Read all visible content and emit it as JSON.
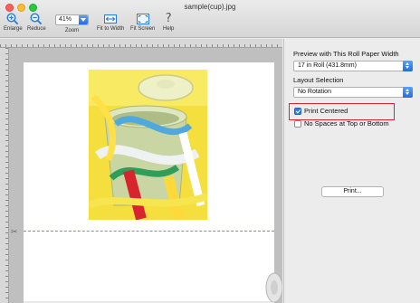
{
  "window": {
    "title": "sample(cup).jpg"
  },
  "toolbar": {
    "enlarge": {
      "label": "Enlarge",
      "icon": "zoom-in-icon"
    },
    "reduce": {
      "label": "Reduce",
      "icon": "zoom-out-icon"
    },
    "zoom": {
      "value": "41%",
      "label": "Zoom"
    },
    "fit_width": {
      "label": "Fit to Width",
      "icon": "fit-width-icon"
    },
    "fit_screen": {
      "label": "Fit Screen",
      "icon": "fit-screen-icon"
    },
    "help": {
      "label": "Help",
      "icon": "help-icon"
    }
  },
  "panel": {
    "roll_width_label": "Preview with This Roll Paper Width",
    "roll_width_value": "17 in Roll (431.8mm)",
    "layout_label": "Layout Selection",
    "layout_value": "No Rotation",
    "print_centered": {
      "label": "Print Centered",
      "checked": true
    },
    "no_spaces": {
      "label": "No Spaces at Top or Bottom",
      "checked": false
    },
    "print_button": "Print..."
  },
  "colors": {
    "accent": "#2f7de1",
    "highlight": "#d9232d",
    "cut_line": "#8b7fd8"
  }
}
